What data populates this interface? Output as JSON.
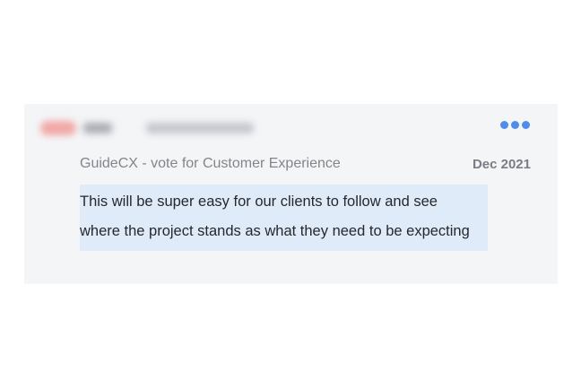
{
  "review": {
    "source": "GuideCX - vote for Customer Experience",
    "date": "Dec 2021",
    "comment": "This will be super easy for our clients to follow and see where the project stands as what they need to be expecting",
    "more_icon": "more-horizontal-icon",
    "accent_color": "#4f8de8",
    "highlight_color": "#e0ebf9"
  }
}
